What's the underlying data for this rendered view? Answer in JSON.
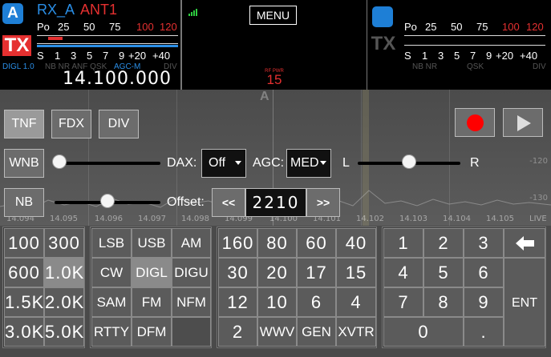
{
  "sliceA": {
    "letter": "A",
    "rx_label": "RX_A",
    "ant_label": "ANT1",
    "tx_label": "TX",
    "power_scale": [
      "Po",
      "25",
      "50",
      "75",
      "100",
      "120"
    ],
    "s_scale": [
      "S",
      "1",
      "3",
      "5",
      "7",
      "9",
      "+20",
      "+40"
    ],
    "mode_line": "DIGL  1.0",
    "flags": "NB NR ANF QSK",
    "agc": "AGC-M",
    "div": "DIV",
    "frequency": "14.100.000"
  },
  "center": {
    "menu_label": "MENU",
    "rf_power_label": "RF PWR",
    "rf_power_value": "15"
  },
  "sliceB": {
    "tx_label": "TX",
    "power_scale": [
      "Po",
      "25",
      "50",
      "75",
      "100",
      "120"
    ],
    "s_scale": [
      "S",
      "1",
      "3",
      "5",
      "7",
      "9",
      "+20",
      "+40"
    ],
    "flags_left": "NB NR",
    "flags_mid": "QSK",
    "div": "DIV"
  },
  "spectrum": {
    "ghost_letter": "A",
    "freq_ticks": [
      "14.094",
      "14.095",
      "14.096",
      "14.097",
      "14.098",
      "14.099",
      "14.100",
      "14.101",
      "14.102",
      "14.103",
      "14.104",
      "14.105"
    ],
    "live": "LIVE",
    "dbm_ticks": [
      "-120",
      "-130",
      "-135",
      "-140",
      "-145"
    ]
  },
  "controls": {
    "tnf": "TNF",
    "fdx": "FDX",
    "div": "DIV",
    "wnb": "WNB",
    "dax_label": "DAX:",
    "dax_value": "Off",
    "agc_label": "AGC:",
    "agc_value": "MED",
    "pan_left": "L",
    "pan_right": "R",
    "nb": "NB",
    "offset_label": "Offset:",
    "offset_down": "<<",
    "offset_value": "2210",
    "offset_up": ">>",
    "wnb_level": 0.0,
    "pan_level": 0.5,
    "nb_level": 0.5
  },
  "filters": [
    "100",
    "300",
    "600",
    "1.0K",
    "1.5K",
    "2.0K",
    "3.0K",
    "5.0K"
  ],
  "filter_selected": "1.0K",
  "modes": [
    "LSB",
    "USB",
    "AM",
    "CW",
    "DIGL",
    "DIGU",
    "SAM",
    "FM",
    "NFM",
    "RTTY",
    "DFM",
    ""
  ],
  "mode_selected": "DIGL",
  "bands": [
    "160",
    "80",
    "60",
    "40",
    "30",
    "20",
    "17",
    "15",
    "12",
    "10",
    "6",
    "4",
    "2",
    "WWV",
    "GEN",
    "XVTR"
  ],
  "keypad": {
    "keys": [
      "1",
      "2",
      "3",
      "4",
      "5",
      "6",
      "7",
      "8",
      "9",
      "0",
      "."
    ],
    "backspace_icon": "left-arrow-icon",
    "enter": "ENT"
  },
  "colors": {
    "slice_blue": "#1e7fd6",
    "tx_red": "#e53030",
    "record_red": "#ff0000"
  }
}
